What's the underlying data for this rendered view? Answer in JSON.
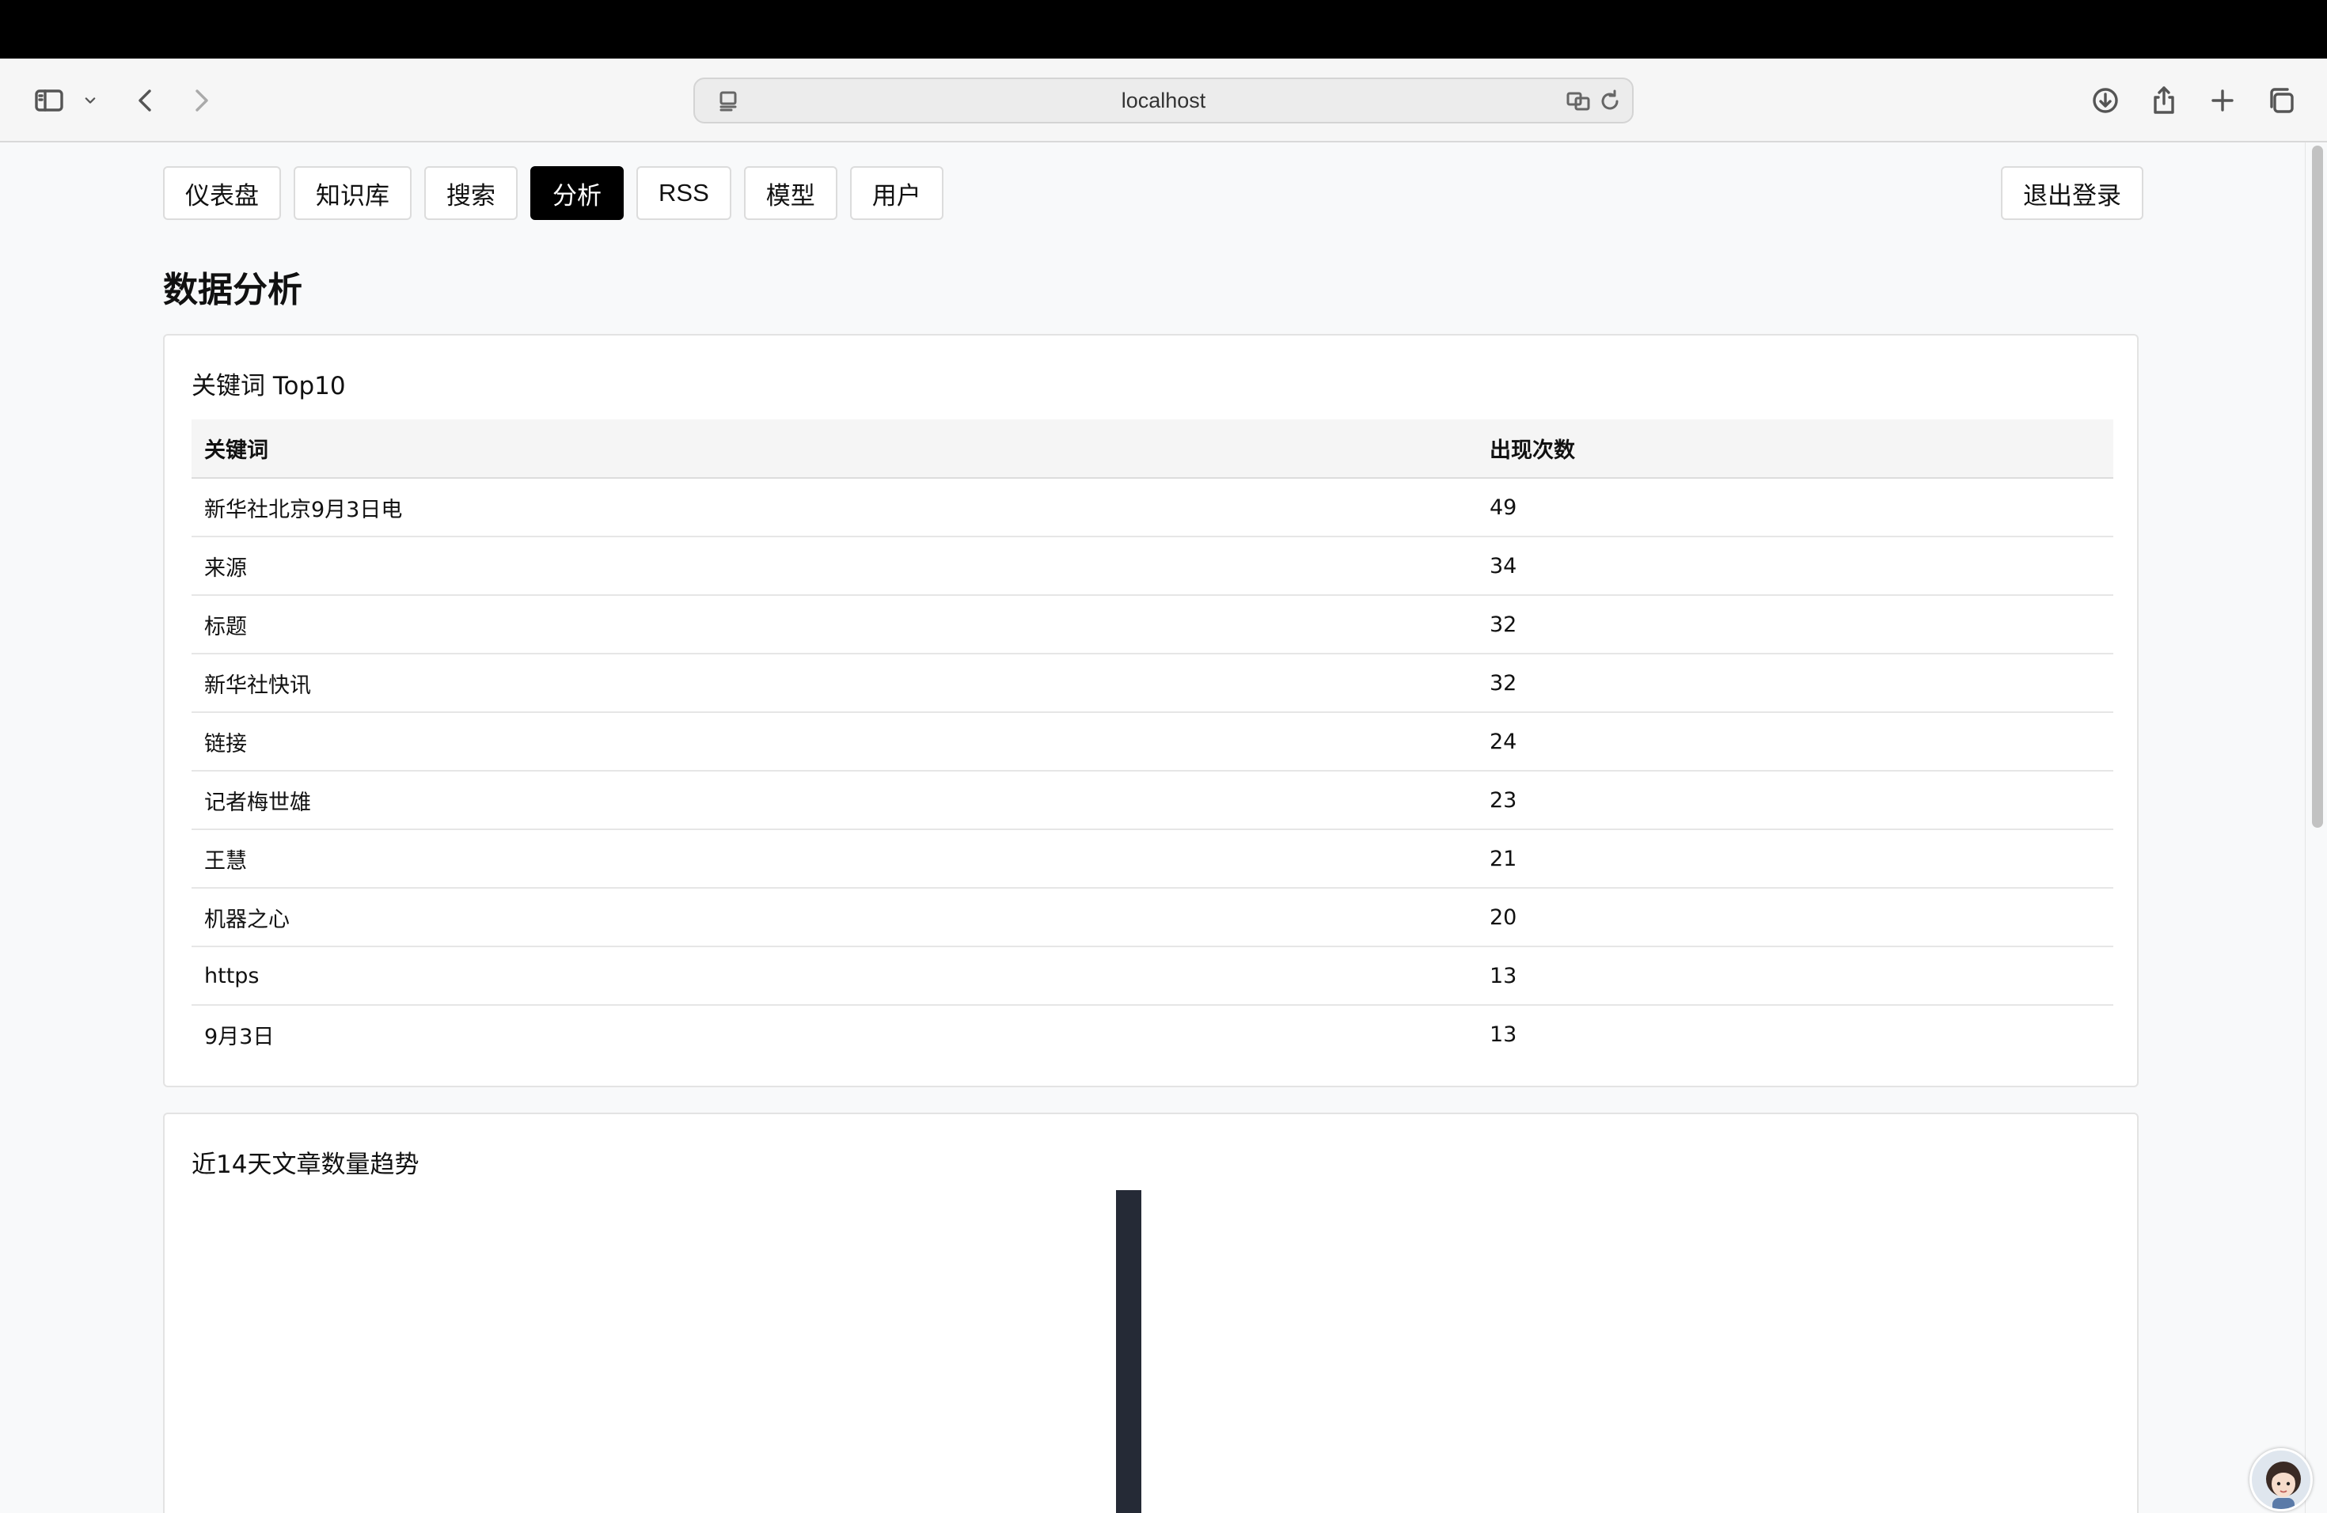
{
  "browser": {
    "url": "localhost"
  },
  "nav": {
    "items": [
      {
        "label": "仪表盘",
        "active": false
      },
      {
        "label": "知识库",
        "active": false
      },
      {
        "label": "搜索",
        "active": false
      },
      {
        "label": "分析",
        "active": true
      },
      {
        "label": "RSS",
        "active": false
      },
      {
        "label": "模型",
        "active": false
      },
      {
        "label": "用户",
        "active": false
      }
    ],
    "logout_label": "退出登录"
  },
  "page": {
    "title": "数据分析"
  },
  "keywords_card": {
    "title": "关键词 Top10",
    "columns": [
      "关键词",
      "出现次数"
    ],
    "rows": [
      [
        "新华社北京9月3日电",
        "49"
      ],
      [
        "来源",
        "34"
      ],
      [
        "标题",
        "32"
      ],
      [
        "新华社快讯",
        "32"
      ],
      [
        "链接",
        "24"
      ],
      [
        "记者梅世雄",
        "23"
      ],
      [
        "王慧",
        "21"
      ],
      [
        "机器之心",
        "20"
      ],
      [
        "https",
        "13"
      ],
      [
        "9月3日",
        "13"
      ]
    ]
  },
  "trend_card": {
    "title": "近14天文章数量趋势"
  },
  "chart_data": {
    "type": "bar",
    "title": "近14天文章数量趋势",
    "note": "only the top of a single tall bar is visible; values and axes are cut off by the viewport",
    "bar_color": "#252a36"
  },
  "colors": {
    "active_nav_bg": "#000000",
    "bar": "#252a36"
  }
}
